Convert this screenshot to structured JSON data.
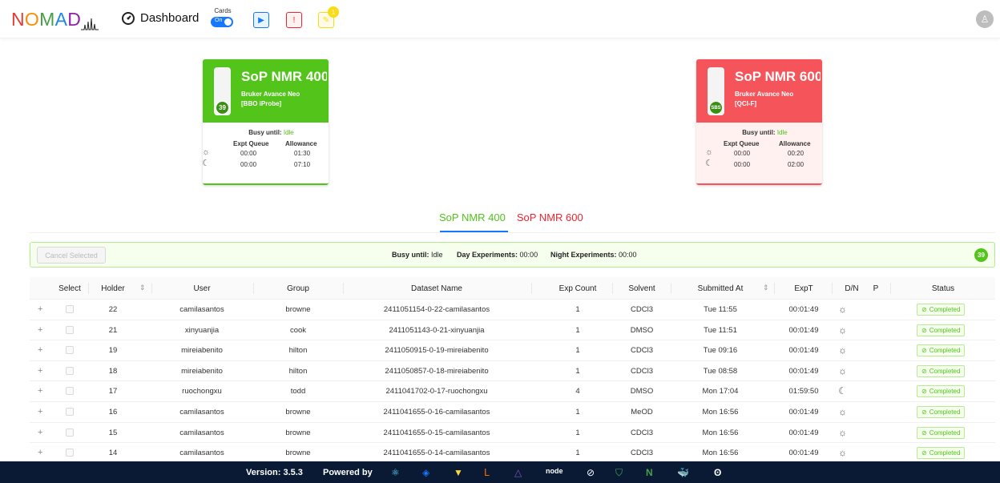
{
  "header": {
    "logo_letters": [
      {
        "ch": "N",
        "color": "#e53935"
      },
      {
        "ch": "O",
        "color": "#fb8c00"
      },
      {
        "ch": "M",
        "color": "#43a047"
      },
      {
        "ch": "A",
        "color": "#1e88e5"
      },
      {
        "ch": "D",
        "color": "#8e24aa"
      }
    ],
    "dashboard_label": "Dashboard",
    "cards_label": "Cards",
    "cards_switch_label": "On",
    "notification_count": "1"
  },
  "instruments": [
    {
      "name": "SoP NMR 400",
      "model": "Bruker Avance Neo",
      "probe": "[BBO iProbe]",
      "holder": "39",
      "busy_label": "Busy until:",
      "busy_value": "Idle",
      "queue_label": "Expt Queue",
      "allowance_label": "Allowance",
      "day_queue": "00:00",
      "day_allowance": "01:30",
      "night_queue": "00:00",
      "night_allowance": "07:10",
      "color": "#52c41a",
      "bg": "#ffffff"
    },
    {
      "name": "SoP NMR 600",
      "model": "Bruker Avance Neo",
      "probe": "[QCI-F]",
      "holder": "SBS",
      "busy_label": "Busy until:",
      "busy_value": "Idle",
      "queue_label": "Expt Queue",
      "allowance_label": "Allowance",
      "day_queue": "00:00",
      "day_allowance": "00:20",
      "night_queue": "00:00",
      "night_allowance": "02:00",
      "color": "#f5545a",
      "bg": "#fff1f0"
    }
  ],
  "tabs": [
    {
      "label": "SoP NMR 400",
      "color": "#52c41a"
    },
    {
      "label": "SoP NMR 600",
      "color": "#f5222d"
    }
  ],
  "status_bar": {
    "cancel_label": "Cancel Selected",
    "busy_label": "Busy until:",
    "busy_value": "Idle",
    "day_label": "Day Experiments:",
    "day_value": "00:00",
    "night_label": "Night Experiments:",
    "night_value": "00:00",
    "badge": "39"
  },
  "table": {
    "columns": [
      "Select",
      "Holder",
      "User",
      "Group",
      "Dataset Name",
      "Exp Count",
      "Solvent",
      "Submitted At",
      "ExpT",
      "D/N",
      "P",
      "Status"
    ],
    "rows": [
      {
        "holder": "22",
        "user": "camilasantos",
        "group": "browne",
        "dataset": "2411051154-0-22-camilasantos",
        "count": "1",
        "solvent": "CDCl3",
        "submitted": "Tue 11:55",
        "expt": "00:01:49",
        "dn": "day",
        "status": "Completed"
      },
      {
        "holder": "21",
        "user": "xinyuanjia",
        "group": "cook",
        "dataset": "2411051143-0-21-xinyuanjia",
        "count": "1",
        "solvent": "DMSO",
        "submitted": "Tue 11:51",
        "expt": "00:01:49",
        "dn": "day",
        "status": "Completed"
      },
      {
        "holder": "19",
        "user": "mireiabenito",
        "group": "hilton",
        "dataset": "2411050915-0-19-mireiabenito",
        "count": "1",
        "solvent": "CDCl3",
        "submitted": "Tue 09:16",
        "expt": "00:01:49",
        "dn": "day",
        "status": "Completed"
      },
      {
        "holder": "18",
        "user": "mireiabenito",
        "group": "hilton",
        "dataset": "2411050857-0-18-mireiabenito",
        "count": "1",
        "solvent": "CDCl3",
        "submitted": "Tue 08:58",
        "expt": "00:01:49",
        "dn": "day",
        "status": "Completed"
      },
      {
        "holder": "17",
        "user": "ruochongxu",
        "group": "todd",
        "dataset": "2411041702-0-17-ruochongxu",
        "count": "4",
        "solvent": "DMSO",
        "submitted": "Mon 17:04",
        "expt": "01:59:50",
        "dn": "night",
        "status": "Completed"
      },
      {
        "holder": "16",
        "user": "camilasantos",
        "group": "browne",
        "dataset": "2411041655-0-16-camilasantos",
        "count": "1",
        "solvent": "MeOD",
        "submitted": "Mon 16:56",
        "expt": "00:01:49",
        "dn": "day",
        "status": "Completed"
      },
      {
        "holder": "15",
        "user": "camilasantos",
        "group": "browne",
        "dataset": "2411041655-0-15-camilasantos",
        "count": "1",
        "solvent": "CDCl3",
        "submitted": "Mon 16:56",
        "expt": "00:01:49",
        "dn": "day",
        "status": "Completed"
      },
      {
        "holder": "14",
        "user": "camilasantos",
        "group": "browne",
        "dataset": "2411041655-0-14-camilasantos",
        "count": "1",
        "solvent": "CDCl3",
        "submitted": "Mon 16:56",
        "expt": "00:01:49",
        "dn": "day",
        "status": "Completed"
      }
    ]
  },
  "footer": {
    "version": "Version: 3.5.3",
    "powered_by": "Powered by",
    "node_label": "node"
  }
}
